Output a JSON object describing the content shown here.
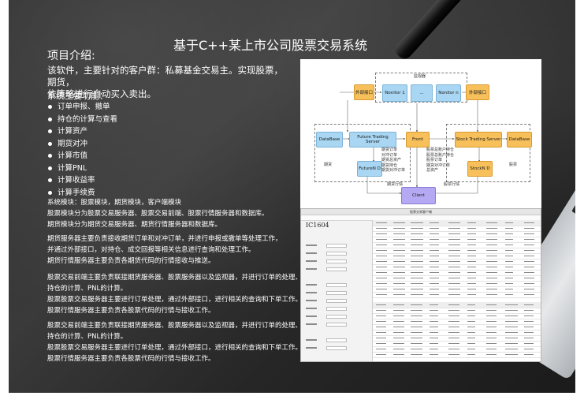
{
  "slide": {
    "title": "基于C++某上市公司股票交易系统",
    "section_title": "项目介绍:",
    "intro_line1": "该软件，主要针对的客户群：私募基金交易主。实现股票，期货，",
    "intro_line2": "依策略进行自动买入卖出。",
    "functions_title": "系统主要功能：",
    "functions": [
      "订单申报、撤单",
      "持仓的计算与查看",
      "计算资产",
      "期货对冲",
      "计算市值",
      "计算PNL",
      "计算收益率",
      "计算手续费"
    ],
    "para1": [
      "系统模块：股票模块，期货模块，客户端模块",
      "股票模块分为股票交易服务器、股票交易前端、股票行情服务器和数据库。",
      "期货模块分为期货交易服务器、期货行情服务器和数据库。"
    ],
    "para2": [
      "期货服务器主要负责接收期货订单和对冲订单，并进行申报或撤单等处理工作，",
      "并通过外部接口，对持仓、成交回报等相关信息进行查询和处理工作。",
      "期货行情服务器主要负责各期货代码的行情接收与推送。"
    ],
    "para3": [
      "股票交易前端主要负责联接期货服务器、股票服务器以及监视器，并进行订单的处理、",
      "持仓的计算、PNL的计算。",
      "股票股票交易服务器主要进行订单处理，通过外部接口，进行相关的查询和下单工作。",
      "股票行情服务器主要负责各股票代码的行情与接收工作。"
    ],
    "para4": [
      "股票交易前端主要负责联接期货服务器、股票服务器以及监视器，并进行订单的处理、",
      "持仓的计算、PNL的计算。",
      "股票股票交易服务器主要进行订单处理，通过外部接口，进行相关的查询和下单工作。",
      "股票行情服务器主要负责各股票代码的行情与接收工作。"
    ]
  },
  "diagram": {
    "monitor_group": "监视器",
    "monitor1": "Nonitor 1",
    "monitor_mid": "...",
    "monitorn": "Nonitor n",
    "ext_left": "外部接口",
    "ext_right": "外部接口",
    "db_left": "DataBase",
    "future_server": "Future Trading Server",
    "front": "Front",
    "stock_server": "Stock Trading Server",
    "db_right": "DataBase",
    "futures_label": "期货",
    "stock_label": "股票",
    "future_nd": "FutureN D",
    "stock_nd": "StockN D",
    "client": "Client",
    "left_notes": [
      "期货订单",
      "对冲订单",
      "期货总资产",
      "期货持仓",
      "期货对冲订单"
    ],
    "right_notes": [
      "股票总账户持仓",
      "股票总账户持仓",
      "股票订单",
      "期货对冲订单",
      "总资产"
    ],
    "future_quote": "期货行情",
    "stock_quote": "股票行情"
  },
  "screenshot": {
    "window_title": "股票交易客户端",
    "code": "IC1604"
  },
  "colors": {
    "background": "#2e2e2e",
    "diagram_blue": "#a9d6f2",
    "diagram_orange": "#f7c05a",
    "diagram_purple": "#b6a9f3"
  }
}
